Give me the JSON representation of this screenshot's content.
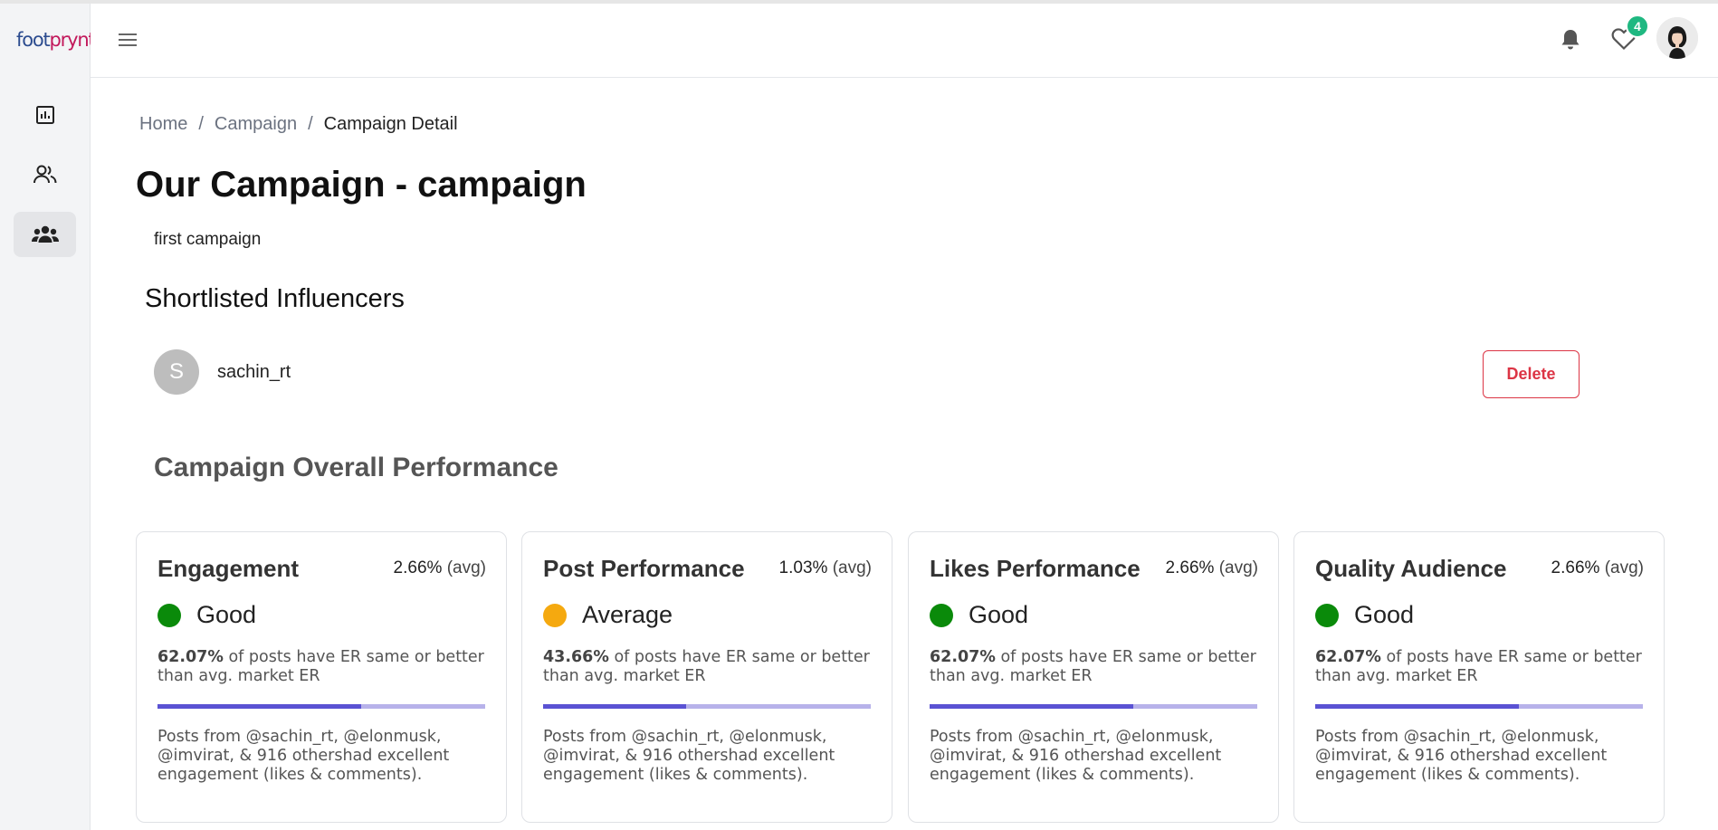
{
  "app": {
    "logo_part1": "foot",
    "logo_part2": "prynt"
  },
  "sidebar": {
    "items": [
      {
        "name": "dashboard",
        "icon": "bar-chart-icon",
        "active": false
      },
      {
        "name": "influencers",
        "icon": "users-icon",
        "active": false
      },
      {
        "name": "campaigns",
        "icon": "group-icon",
        "active": true
      }
    ]
  },
  "header": {
    "favorites_count": "4"
  },
  "breadcrumb": {
    "home": "Home",
    "sep1": "/",
    "campaign": "Campaign",
    "sep2": "/",
    "current": "Campaign Detail"
  },
  "page": {
    "title": "Our Campaign - campaign",
    "description": "first campaign",
    "shortlisted_title": "Shortlisted Influencers"
  },
  "influencer": {
    "initial": "S",
    "name": "sachin_rt",
    "delete_label": "Delete"
  },
  "performance": {
    "title": "Campaign Overall Performance",
    "cards": [
      {
        "title": "Engagement",
        "avg_value": "2.66%",
        "avg_label": "(avg)",
        "rating": "Good",
        "rating_color": "#0a8a0a",
        "stat_value": "62.07%",
        "stat_text": " of posts have ER same or better than avg. market ER",
        "progress": 0.6207,
        "note": "Posts from @sachin_rt, @elonmusk, @imvirat, & 916 othershad excellent engagement (likes & comments)."
      },
      {
        "title": "Post Performance",
        "avg_value": "1.03%",
        "avg_label": "(avg)",
        "rating": "Average",
        "rating_color": "#f5a90f",
        "stat_value": "43.66%",
        "stat_text": " of posts have ER same or better than avg. market ER",
        "progress": 0.4366,
        "note": "Posts from @sachin_rt, @elonmusk, @imvirat, & 916 othershad excellent engagement (likes & comments)."
      },
      {
        "title": "Likes Performance",
        "avg_value": "2.66%",
        "avg_label": "(avg)",
        "rating": "Good",
        "rating_color": "#0a8a0a",
        "stat_value": "62.07%",
        "stat_text": " of posts have ER same or better than avg. market ER",
        "progress": 0.6207,
        "note": "Posts from @sachin_rt, @elonmusk, @imvirat, & 916 othershad excellent engagement (likes & comments)."
      },
      {
        "title": "Quality Audience",
        "avg_value": "2.66%",
        "avg_label": "(avg)",
        "rating": "Good",
        "rating_color": "#0a8a0a",
        "stat_value": "62.07%",
        "stat_text": " of posts have ER same or better than avg. market ER",
        "progress": 0.6207,
        "note": "Posts from @sachin_rt, @elonmusk, @imvirat, & 916 othershad excellent engagement (likes & comments)."
      }
    ]
  }
}
